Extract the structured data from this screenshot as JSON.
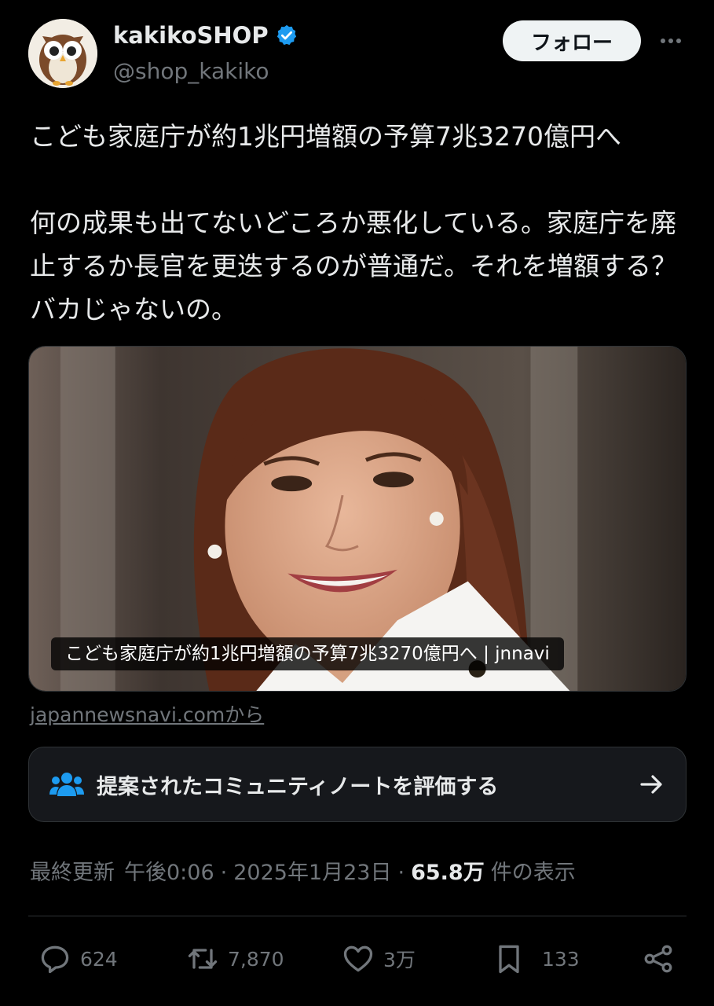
{
  "user": {
    "display_name": "kakikoSHOP",
    "handle": "@shop_kakiko",
    "avatar_icon": "owl-avatar-icon",
    "verified_icon": "verified-badge-icon",
    "verified_color": "#1d9bf0"
  },
  "header": {
    "follow_label": "フォロー",
    "more_icon": "more-dots-icon"
  },
  "tweet": {
    "text": "こども家庭庁が約1兆円増額の予算7兆3270億円へ\n\n何の成果も出てないどころか悪化している。家庭庁を廃止するか長官を更迭するのが普通だ。それを増額する？バカじゃないの。"
  },
  "card": {
    "image_description_icon": "news-photo",
    "caption": "こども家庭庁が約1兆円増額の予算7兆3270億円へ | jnnavi",
    "source": "japannewsnavi.comから"
  },
  "community_note": {
    "icon": "people-icon",
    "label": "提案されたコミュニティノートを評価する",
    "arrow_icon": "arrow-right-icon",
    "accent": "#1d9bf0"
  },
  "meta": {
    "prefix": "最終更新",
    "time": "午後0:06",
    "separator": "·",
    "date": "2025年1月23日",
    "views_count": "65.8万",
    "views_label": "件の表示"
  },
  "actions": {
    "replies": "624",
    "retweets": "7,870",
    "likes": "3万",
    "bookmarks": "133"
  }
}
